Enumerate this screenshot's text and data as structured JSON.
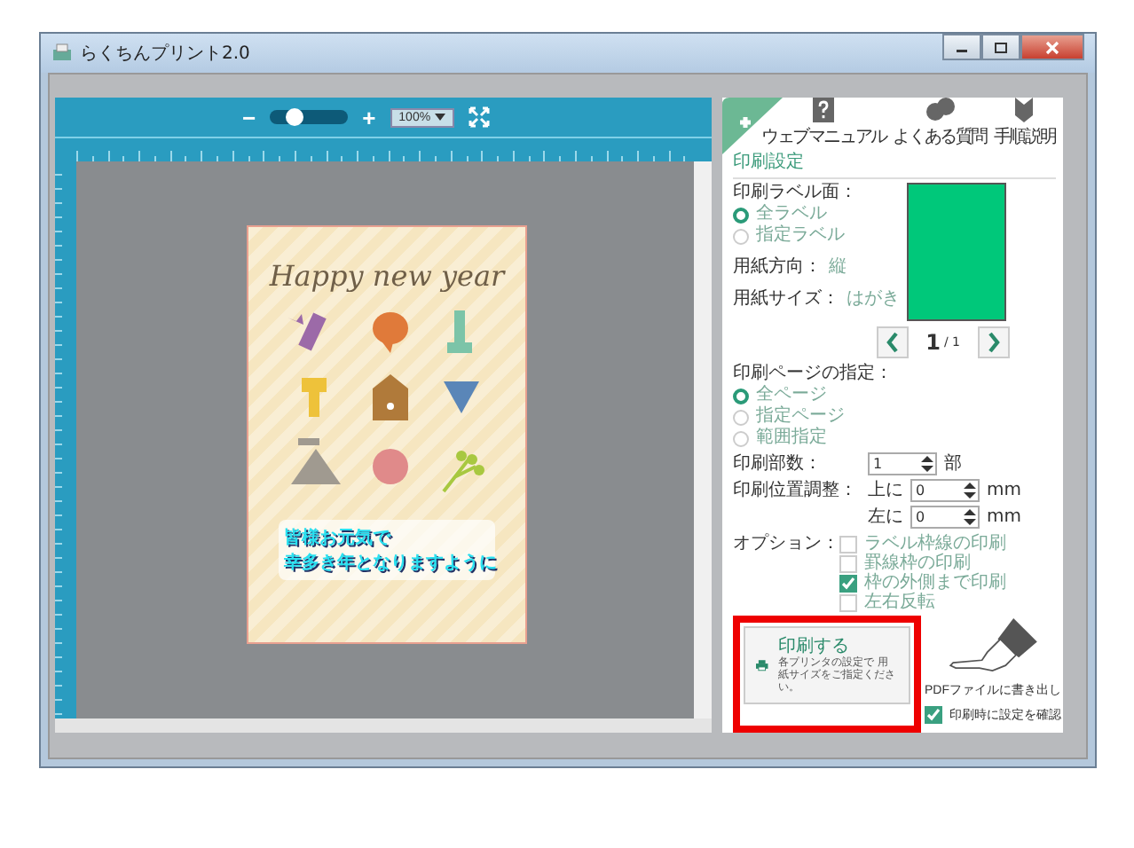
{
  "window": {
    "title": "らくちんプリント2.0"
  },
  "toolbar": {
    "zoom_out": "−",
    "zoom_in": "+",
    "level": 0.25,
    "zoom_value": "100%"
  },
  "card": {
    "title": "Happy new year",
    "message_lines": [
      "皆様お元気で",
      "幸多き年となりますように"
    ]
  },
  "help_links": [
    {
      "label": "ウェブマニュアル",
      "kind": "manual"
    },
    {
      "label": "よくある質問",
      "kind": "faq"
    },
    {
      "label": "手順説明",
      "kind": "guide"
    }
  ],
  "section_title": "印刷設定",
  "label_face": {
    "label": "印刷ラベル面：",
    "options": [
      {
        "label": "全ラベル",
        "selected": true
      },
      {
        "label": "指定ラベル",
        "selected": false
      }
    ]
  },
  "orientation": {
    "label": "用紙方向：",
    "value": "縦"
  },
  "paper_size": {
    "label": "用紙サイズ：",
    "value": "はがき"
  },
  "pager": {
    "page": "1",
    "total": "/ 1"
  },
  "page_range": {
    "label": "印刷ページの指定：",
    "options": [
      {
        "label": "全ページ",
        "selected": true
      },
      {
        "label": "指定ページ",
        "selected": false
      },
      {
        "label": "範囲指定",
        "selected": false
      }
    ]
  },
  "copies": {
    "label": "印刷部数：",
    "value": "1",
    "unit": "部"
  },
  "position": {
    "label": "印刷位置調整：",
    "rows": [
      {
        "label": "上に",
        "value": "0",
        "unit": "mm"
      },
      {
        "label": "左に",
        "value": "0",
        "unit": "mm"
      }
    ]
  },
  "options": {
    "label": "オプション：",
    "items": [
      {
        "label": "ラベル枠線の印刷",
        "checked": false
      },
      {
        "label": "罫線枠の印刷",
        "checked": false
      },
      {
        "label": "枠の外側まで印刷",
        "checked": true
      },
      {
        "label": "左右反転",
        "checked": false
      }
    ]
  },
  "print_button": {
    "label": "印刷する",
    "note": "各プリンタの設定で 用紙サイズをご指定ください。"
  },
  "pdf_export": "PDFファイルに書き出し",
  "confirm": {
    "label": "印刷時に設定を確認",
    "checked": true
  }
}
